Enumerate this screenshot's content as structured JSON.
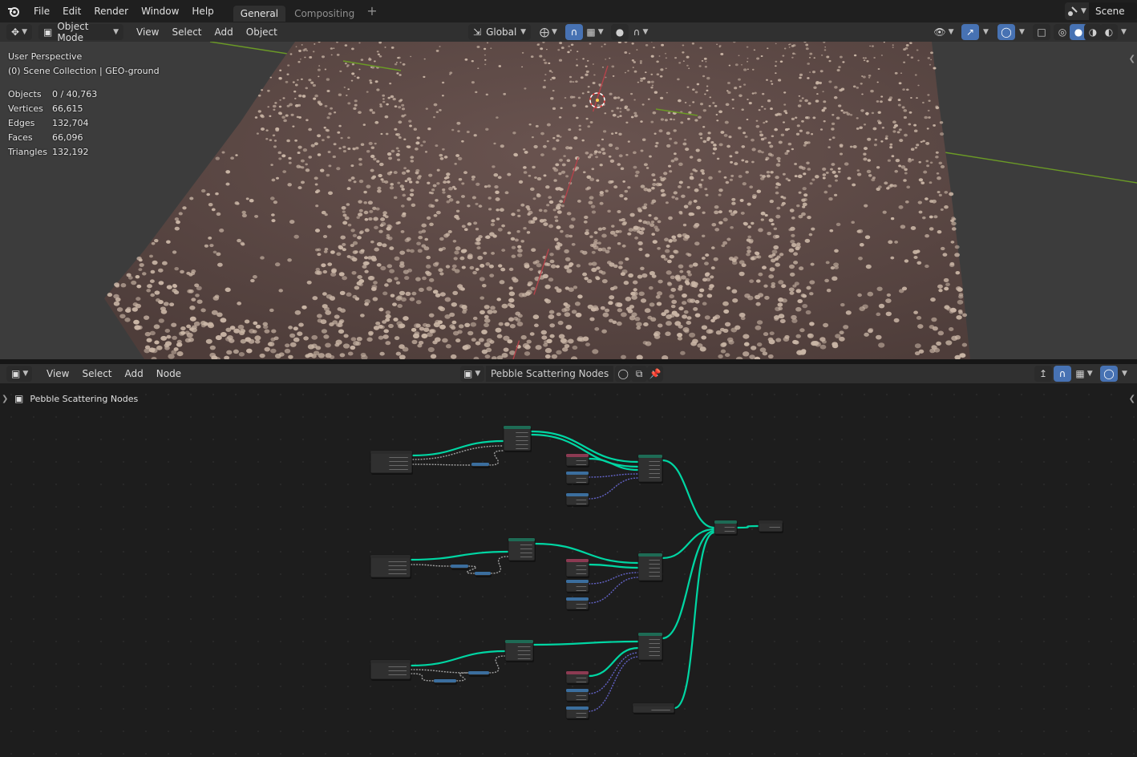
{
  "topbar": {
    "menus": [
      "File",
      "Edit",
      "Render",
      "Window",
      "Help"
    ],
    "tabs": [
      {
        "label": "General",
        "active": true
      },
      {
        "label": "Compositing",
        "active": false
      }
    ],
    "add_tab": "+",
    "scene": "Scene"
  },
  "viewport_header": {
    "mode": "Object Mode",
    "menus": [
      "View",
      "Select",
      "Add",
      "Object"
    ],
    "orientation": "Global"
  },
  "viewport": {
    "perspective": "User Perspective",
    "collection": "(0) Scene Collection | GEO-ground",
    "stats": [
      {
        "key": "Objects",
        "value": "0 / 40,763"
      },
      {
        "key": "Vertices",
        "value": "66,615"
      },
      {
        "key": "Edges",
        "value": "132,704"
      },
      {
        "key": "Faces",
        "value": "66,096"
      },
      {
        "key": "Triangles",
        "value": "132,192"
      }
    ],
    "colors": {
      "ground": "#5d4844",
      "pebble": "#c9b5a5",
      "axis_x": "#b3424a",
      "axis_y": "#6b9a26"
    }
  },
  "node_header": {
    "menus": [
      "View",
      "Select",
      "Add",
      "Node"
    ],
    "tree_name": "Pebble Scattering Nodes"
  },
  "node_editor": {
    "breadcrumb": "Pebble Scattering Nodes",
    "colors": {
      "geometry_link": "#00d6a3",
      "vector_link": "#6363c7",
      "float_link": "#a1a1a1",
      "header_green": "#1e6b55",
      "header_blue": "#3b6e9e",
      "header_red": "#8c3a52"
    }
  }
}
